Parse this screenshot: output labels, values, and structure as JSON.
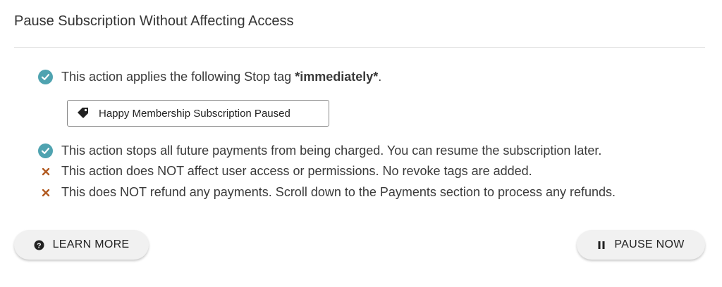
{
  "title": "Pause Subscription Without Affecting Access",
  "items": [
    {
      "icon": "check-icon",
      "text_before": "This action applies the following Stop tag ",
      "text_bold": "*immediately*",
      "text_after": "."
    },
    {
      "icon": "check-icon",
      "text": "This action stops all future payments from being charged. You can resume the subscription later."
    },
    {
      "icon": "x-icon",
      "text": "This action does NOT affect user access or permissions. No revoke tags are added."
    },
    {
      "icon": "x-icon",
      "text": "This does NOT refund any payments. Scroll down to the Payments section to process any refunds."
    }
  ],
  "tag": {
    "icon": "tag-icon",
    "label": "Happy Membership Subscription Paused"
  },
  "buttons": {
    "learn_more": {
      "icon": "question-circle-icon",
      "label": "LEARN MORE"
    },
    "pause_now": {
      "icon": "pause-icon",
      "label": "PAUSE NOW"
    }
  },
  "colors": {
    "check": "#4fa3b0",
    "x": "#b25b22",
    "button_bg": "#f1f1f1"
  }
}
